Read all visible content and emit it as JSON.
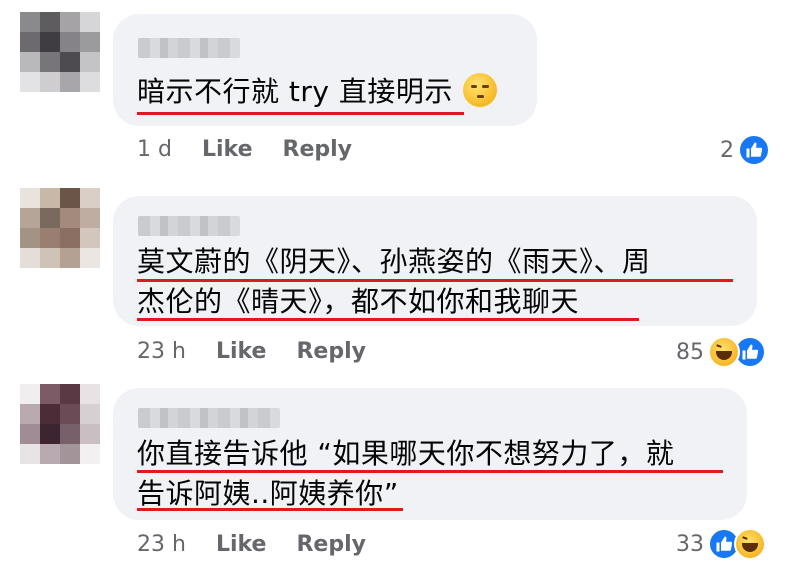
{
  "comments": [
    {
      "text_lines": [
        "暗示不行就 try 直接明示"
      ],
      "time": "1 d",
      "like": "Like",
      "reply": "Reply",
      "reaction_count": "2",
      "reactions": [
        "like-icon"
      ]
    },
    {
      "text_lines": [
        "莫文蔚的《阴天》、孙燕姿的《雨天》、周",
        "杰伦的《晴天》，都不如你和我聊天"
      ],
      "time": "23 h",
      "like": "Like",
      "reply": "Reply",
      "reaction_count": "85",
      "reactions": [
        "haha-icon",
        "like-icon"
      ]
    },
    {
      "text_lines": [
        "你直接告诉他 “如果哪天你不想努力了，就",
        "告诉阿姨..阿姨养你”"
      ],
      "time": "23 h",
      "like": "Like",
      "reply": "Reply",
      "reaction_count": "33",
      "reactions": [
        "like-icon",
        "haha-icon"
      ]
    }
  ],
  "colors": {
    "bubble": "#f0f2f5",
    "underline": "#e0191f",
    "like_blue": "#1877f2",
    "meta_gray": "#65676b"
  }
}
